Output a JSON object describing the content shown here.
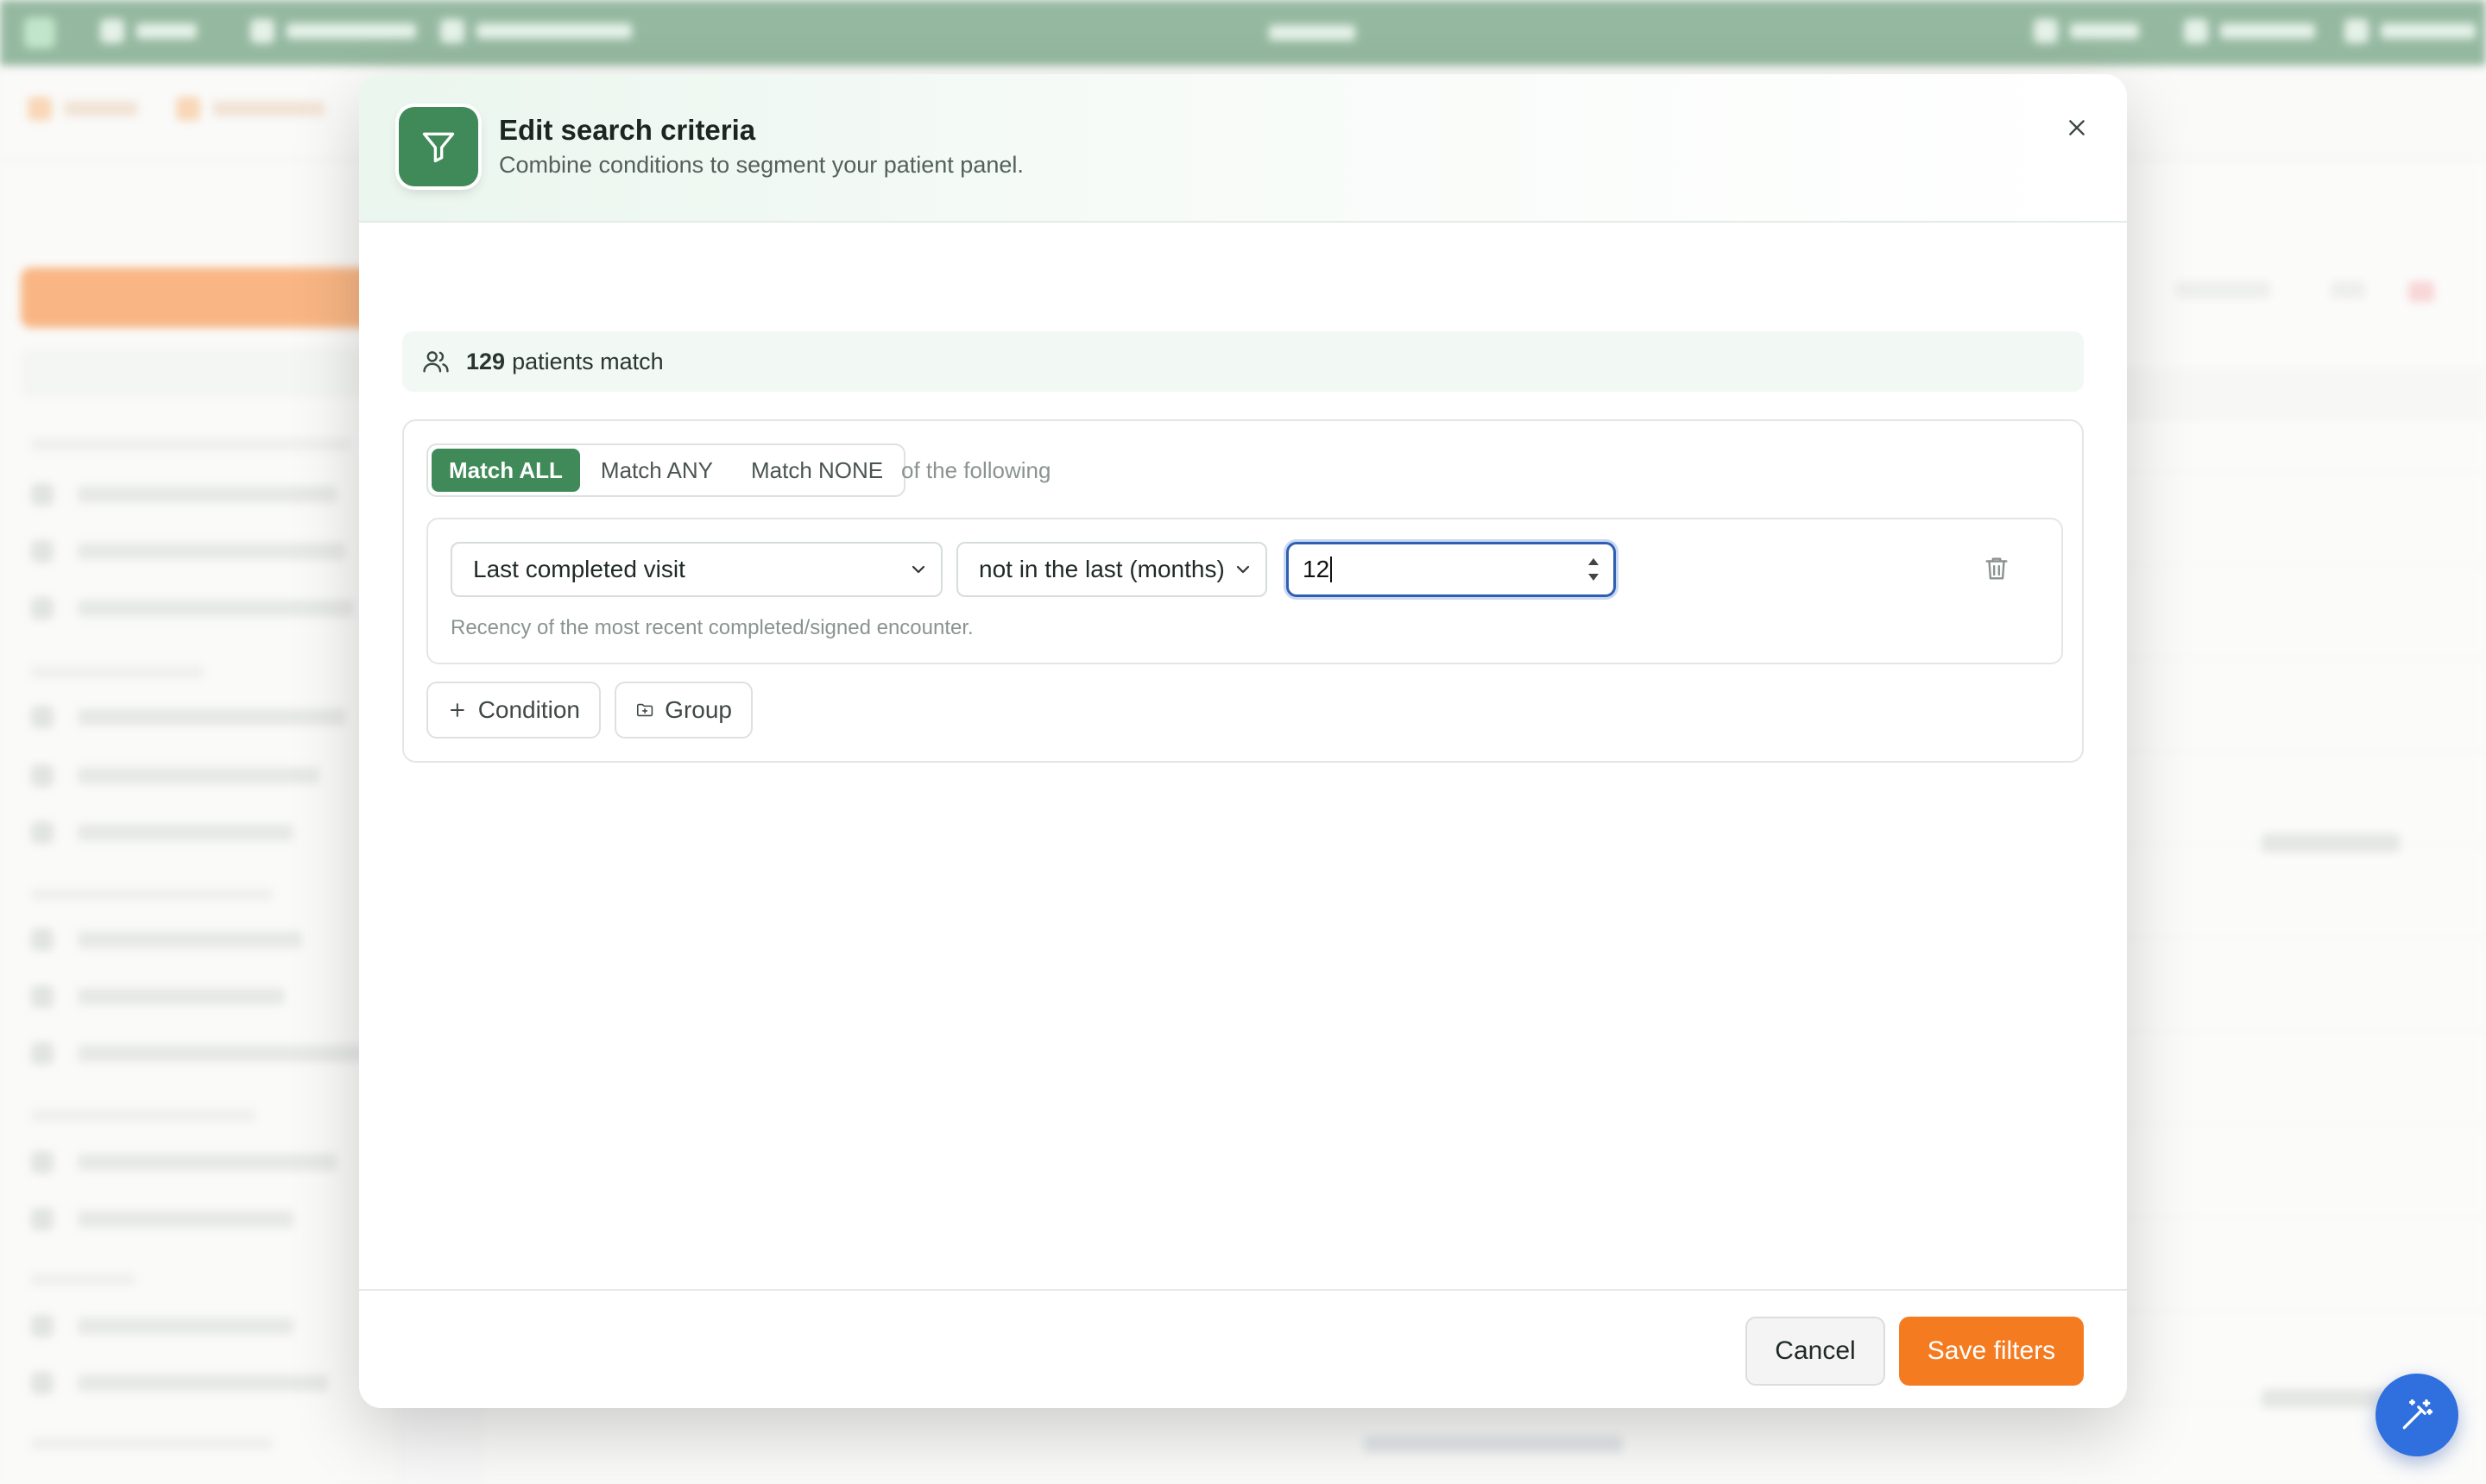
{
  "colors": {
    "brand_green": "#3f8a58",
    "accent_orange": "#f47b20",
    "focus_blue": "#2f5fb0",
    "fab_blue": "#2f6fde"
  },
  "modal": {
    "title": "Edit search criteria",
    "subtitle": "Combine conditions to segment your patient panel.",
    "header_icon": "filter-icon",
    "close_icon": "close-icon",
    "match_count": "129",
    "match_count_label": "patients match",
    "match_modes": [
      "Match ALL",
      "Match ANY",
      "Match NONE"
    ],
    "active_match_mode": "Match ALL",
    "of_following": "of the following",
    "condition": {
      "field": "Last completed visit",
      "operator": "not in the last (months)",
      "value": "12",
      "hint": "Recency of the most recent completed/signed encounter."
    },
    "add_condition_label": "Condition",
    "add_group_label": "Group",
    "cancel_label": "Cancel",
    "save_label": "Save filters"
  },
  "fab_icon": "magic-wand-icon"
}
